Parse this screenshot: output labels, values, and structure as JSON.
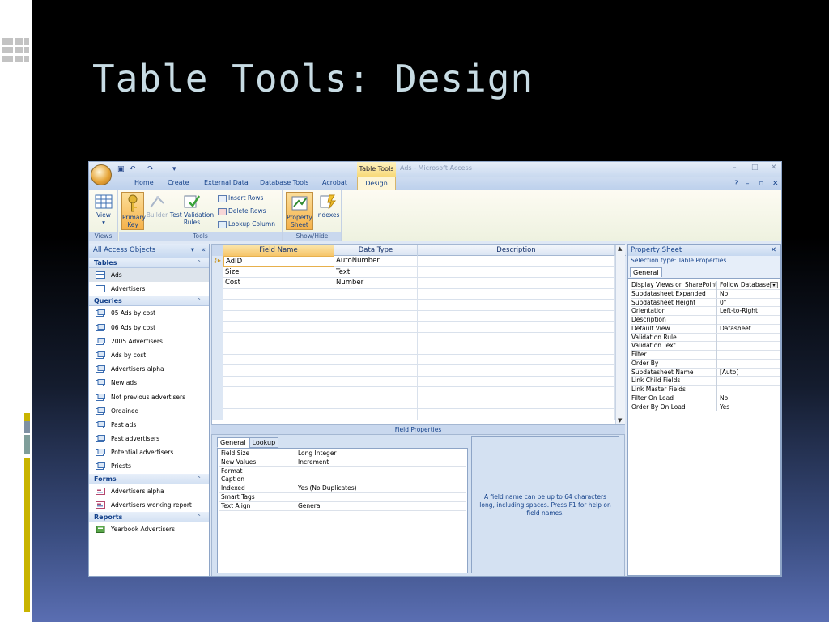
{
  "slide": {
    "title": "Table Tools: Design",
    "bar_colors": [
      "#c9b400",
      "#7f91a3",
      "#7f9e9a",
      "#c9b400"
    ]
  },
  "window": {
    "tool_context": "Table Tools",
    "app_title": "Ads - Microsoft Access",
    "win_min": "–",
    "win_max": "□",
    "win_close": "✕"
  },
  "tabs": [
    "Home",
    "Create",
    "External Data",
    "Database Tools",
    "Acrobat"
  ],
  "active_tab": "Design",
  "ribbon_right": {
    "help": "?",
    "min": "–",
    "restore": "▫",
    "close": "✕"
  },
  "ribbon": {
    "views": {
      "label": "Views",
      "view_btn": "View",
      "view_arrow": "▾"
    },
    "tools": {
      "label": "Tools",
      "primary_key": "Primary Key",
      "builder": "Builder",
      "test_rules": "Test Validation Rules",
      "insert_rows": "Insert Rows",
      "delete_rows": "Delete Rows",
      "lookup_column": "Lookup Column"
    },
    "showhide": {
      "label": "Show/Hide",
      "property_sheet": "Property Sheet",
      "indexes": "Indexes"
    }
  },
  "nav": {
    "title": "All Access Objects",
    "sections": {
      "tables": {
        "label": "Tables",
        "items": [
          "Ads",
          "Advertisers"
        ]
      },
      "queries": {
        "label": "Queries",
        "items": [
          "05 Ads by cost",
          "06 Ads by cost",
          "2005 Advertisers",
          "Ads by cost",
          "Advertisers alpha",
          "New ads",
          "Not previous advertisers",
          "Ordained",
          "Past ads",
          "Past advertisers",
          "Potential advertisers",
          "Priests"
        ]
      },
      "forms": {
        "label": "Forms",
        "items": [
          "Advertisers alpha",
          "Advertisers working report"
        ]
      },
      "reports": {
        "label": "Reports",
        "items": [
          "Yearbook Advertisers"
        ]
      }
    }
  },
  "grid": {
    "headers": [
      "Field Name",
      "Data Type",
      "Description"
    ],
    "rows": [
      [
        "AdID",
        "AutoNumber",
        ""
      ],
      [
        "Size",
        "Text",
        ""
      ],
      [
        "Cost",
        "Number",
        ""
      ]
    ]
  },
  "field_properties": {
    "title": "Field Properties",
    "tabs": [
      "General",
      "Lookup"
    ],
    "rows": [
      [
        "Field Size",
        "Long Integer"
      ],
      [
        "New Values",
        "Increment"
      ],
      [
        "Format",
        ""
      ],
      [
        "Caption",
        ""
      ],
      [
        "Indexed",
        "Yes (No Duplicates)"
      ],
      [
        "Smart Tags",
        ""
      ],
      [
        "Text Align",
        "General"
      ]
    ],
    "help": "A field name can be up to 64 characters long, including spaces.  Press F1 for help on field names."
  },
  "property_sheet": {
    "title": "Property Sheet",
    "selection_type": "Selection type:  Table Properties",
    "tab": "General",
    "rows": [
      [
        "Display Views on SharePoint",
        "Follow Database"
      ],
      [
        "Subdatasheet Expanded",
        "No"
      ],
      [
        "Subdatasheet Height",
        "0\""
      ],
      [
        "Orientation",
        "Left-to-Right"
      ],
      [
        "Description",
        ""
      ],
      [
        "Default View",
        "Datasheet"
      ],
      [
        "Validation Rule",
        ""
      ],
      [
        "Validation Text",
        ""
      ],
      [
        "Filter",
        ""
      ],
      [
        "Order By",
        ""
      ],
      [
        "Subdatasheet Name",
        "[Auto]"
      ],
      [
        "Link Child Fields",
        ""
      ],
      [
        "Link Master Fields",
        ""
      ],
      [
        "Filter On Load",
        "No"
      ],
      [
        "Order By On Load",
        "Yes"
      ]
    ]
  }
}
